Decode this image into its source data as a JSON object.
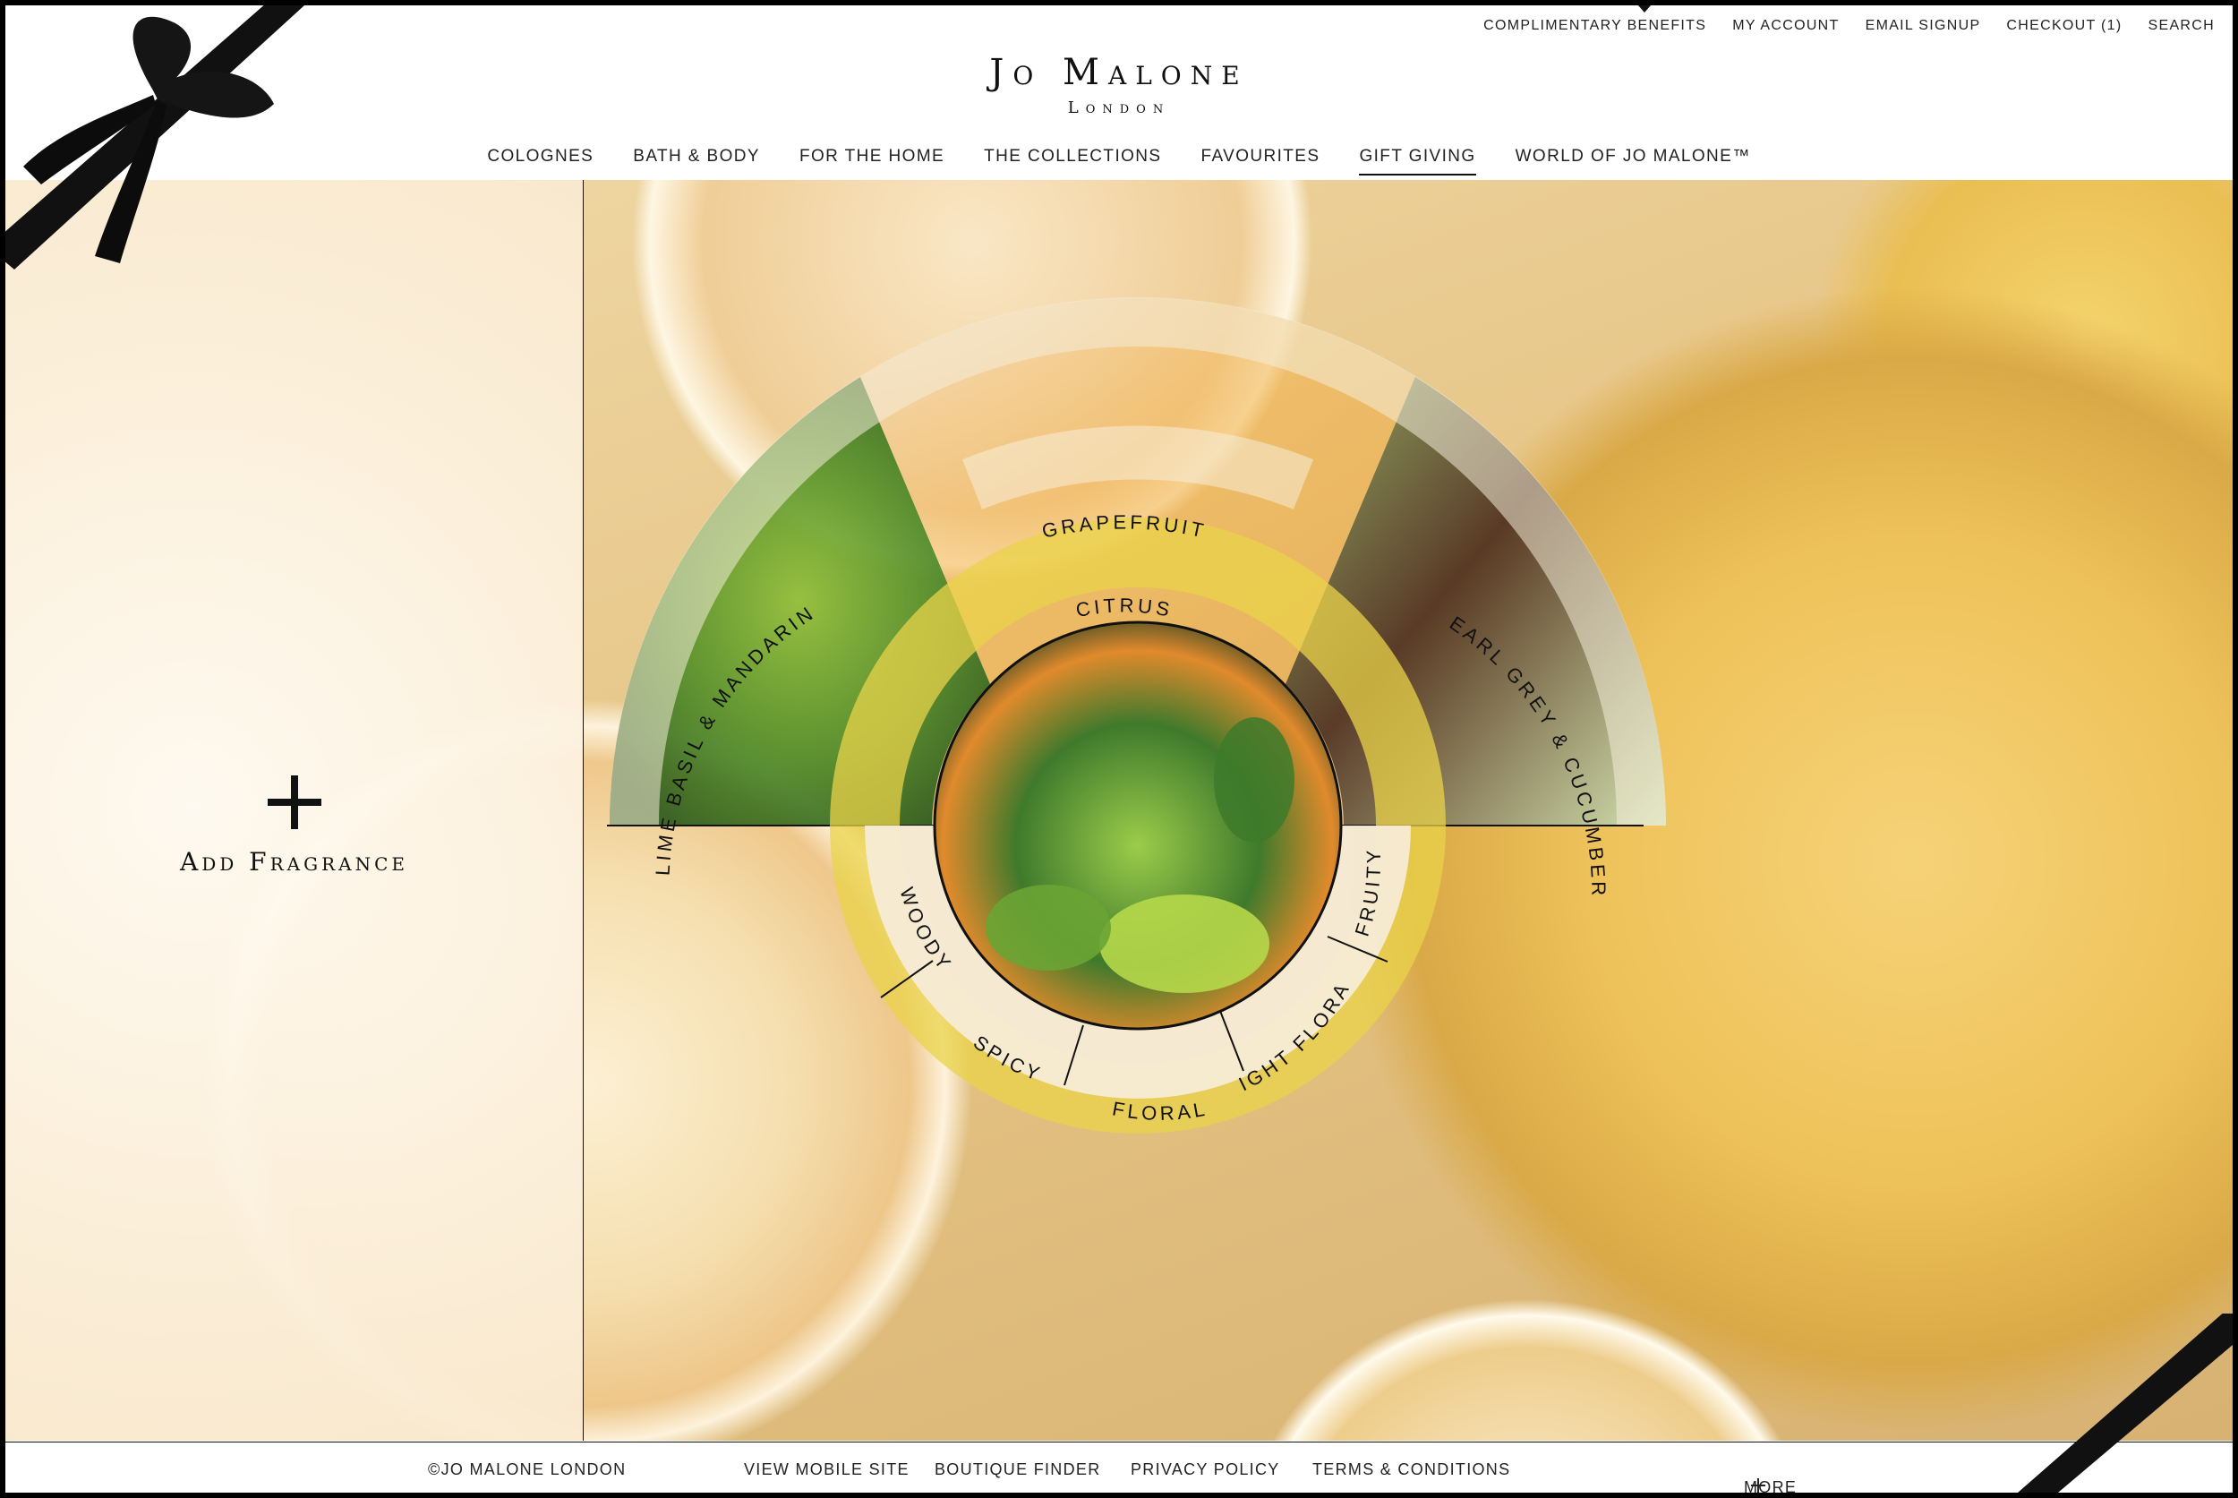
{
  "header": {
    "utility_links": [
      "COMPLIMENTARY BENEFITS",
      "MY ACCOUNT",
      "EMAIL SIGNUP",
      "CHECKOUT (1)",
      "SEARCH"
    ],
    "brand": "Jo Malone",
    "brand_sub": "London",
    "nav": [
      {
        "label": "COLOGNES"
      },
      {
        "label": "BATH & BODY"
      },
      {
        "label": "FOR THE HOME"
      },
      {
        "label": "THE COLLECTIONS"
      },
      {
        "label": "FAVOURITES"
      },
      {
        "label": "GIFT GIVING",
        "active": true
      },
      {
        "label": "WORLD OF JO MALONE™"
      }
    ]
  },
  "left_panel": {
    "add_label": "Add Fragrance",
    "icon": "plus-icon"
  },
  "wheel": {
    "outer": [
      "LIME BASIL & MANDARIN",
      "GRAPEFRUIT",
      "EARL GREY & CUCUMBER"
    ],
    "family": "CITRUS",
    "inner_families": [
      "WOODY",
      "SPICY",
      "FLORAL",
      "LIGHT FLORAL",
      "FRUITY"
    ]
  },
  "footer": {
    "copyright": "©JO MALONE LONDON",
    "links": [
      "VIEW MOBILE SITE",
      "BOUTIQUE FINDER",
      "PRIVACY POLICY",
      "TERMS & CONDITIONS"
    ],
    "more": "MORE"
  },
  "colors": {
    "citrus_ring": "#e9d34a",
    "ribbon": "#111111",
    "text": "#111111"
  }
}
